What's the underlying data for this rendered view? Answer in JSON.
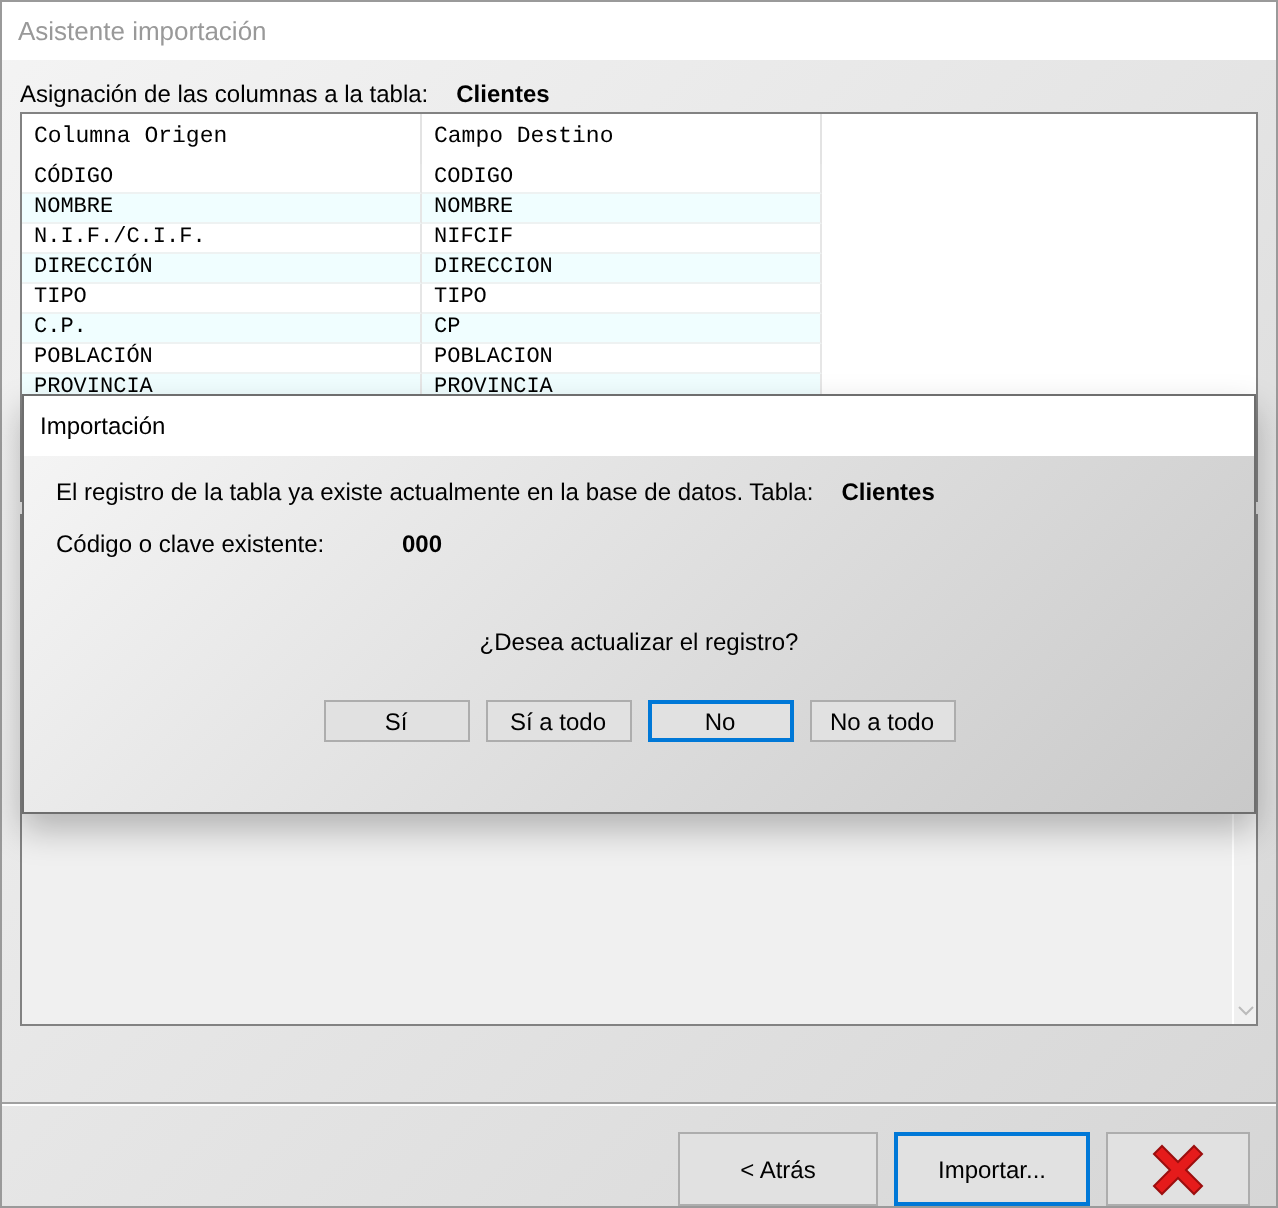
{
  "window": {
    "title": "Asistente importación"
  },
  "mapping": {
    "label": "Asignación de las columnas a la tabla:",
    "table_name": "Clientes"
  },
  "table": {
    "columns": [
      "Columna Origen",
      "Campo Destino"
    ],
    "rows": [
      {
        "source": "CÓDIGO",
        "target": "CODIGO"
      },
      {
        "source": "NOMBRE",
        "target": "NOMBRE"
      },
      {
        "source": "N.I.F./C.I.F.",
        "target": "NIFCIF"
      },
      {
        "source": "DIRECCIÓN",
        "target": "DIRECCION"
      },
      {
        "source": "TIPO",
        "target": "TIPO"
      },
      {
        "source": "C.P.",
        "target": "CP"
      },
      {
        "source": "POBLACIÓN",
        "target": "POBLACION"
      },
      {
        "source": "PROVINCIA",
        "target": "PROVINCIA"
      }
    ]
  },
  "footer_buttons": [
    {
      "kind": "text",
      "label": "< Atrás",
      "default": false
    },
    {
      "kind": "text",
      "label": "Importar...",
      "default": true
    },
    {
      "kind": "cancel",
      "default": false
    }
  ],
  "dialog": {
    "title": "Importación",
    "message": "El registro de la tabla ya existe actualmente en la base de datos. Tabla:",
    "table_name": "Clientes",
    "key_label": "Código o clave existente:",
    "key_value": "000",
    "question": "¿Desea actualizar el registro?",
    "buttons": [
      {
        "label": "Sí",
        "default": false
      },
      {
        "label": "Sí a todo",
        "default": false
      },
      {
        "label": "No",
        "default": true
      },
      {
        "label": "No a todo",
        "default": false
      }
    ]
  }
}
